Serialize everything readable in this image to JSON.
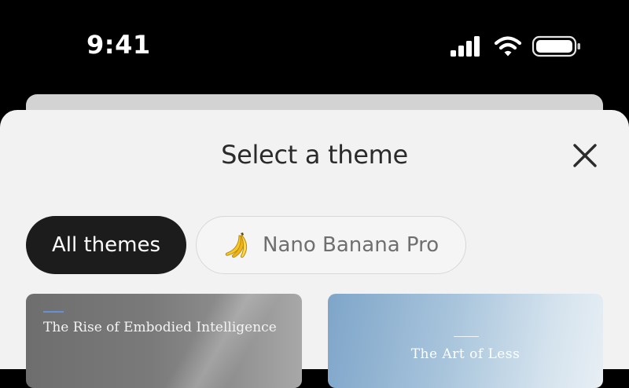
{
  "status_bar": {
    "time": "9:41",
    "icons": [
      "cellular-signal-icon",
      "wifi-icon",
      "battery-icon"
    ]
  },
  "sheet": {
    "title": "Select a theme",
    "close_icon": "close-icon"
  },
  "filters": [
    {
      "label": "All themes",
      "selected": true
    },
    {
      "label": "Nano Banana Pro",
      "icon": "banana-icon",
      "selected": false
    }
  ],
  "themes": [
    {
      "title": "The Rise of Embodied Intelligence"
    },
    {
      "title": "The Art of Less"
    }
  ],
  "colors": {
    "selected_chip": "#1c1c1c",
    "sheet_background": "#f2f2f2",
    "accent": "#6a8fd6"
  }
}
